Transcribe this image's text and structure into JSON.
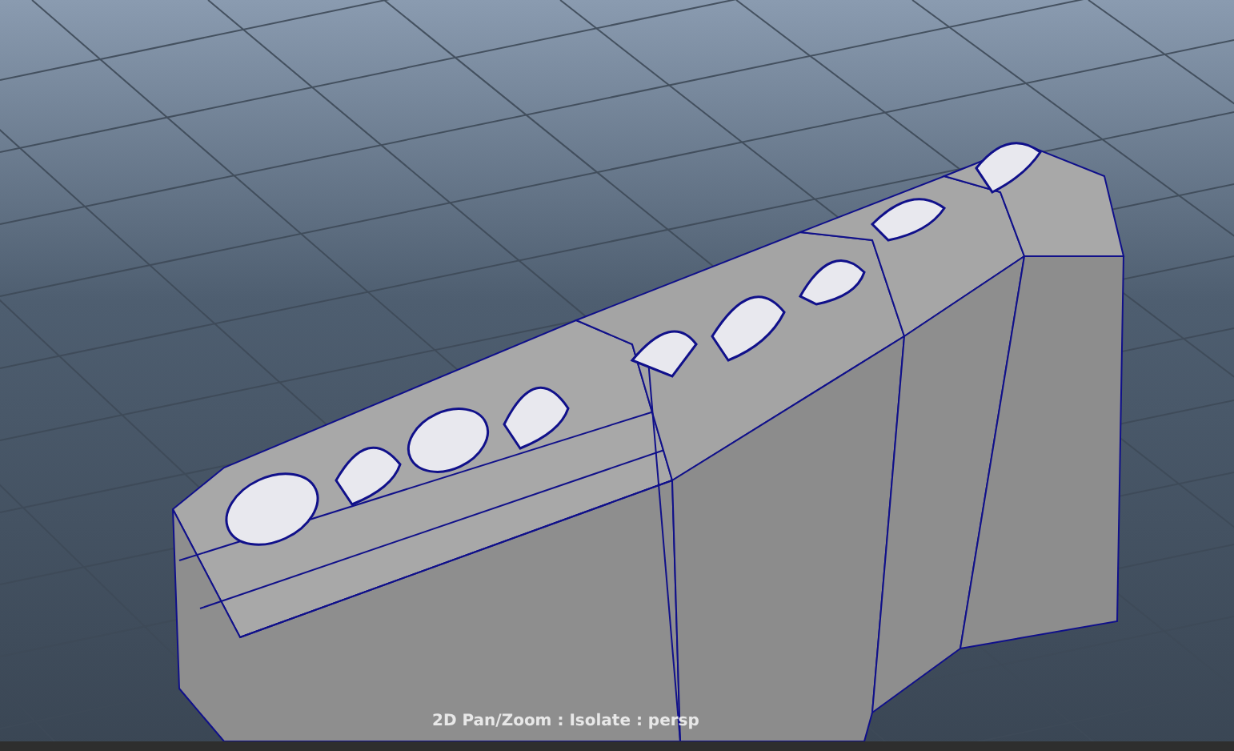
{
  "viewport": {
    "hud_label": "2D Pan/Zoom : Isolate : persp"
  }
}
